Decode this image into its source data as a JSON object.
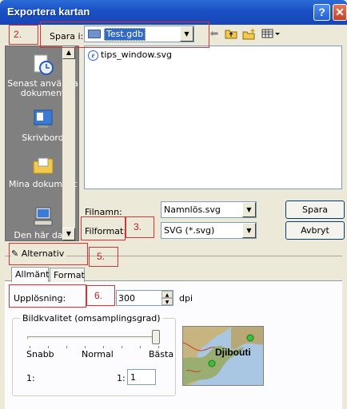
{
  "window": {
    "title": "Exportera kartan",
    "help_label": "?",
    "close_label": "✕"
  },
  "places": [
    {
      "label": "Senast använda dokument",
      "icon": "recent-documents-icon"
    },
    {
      "label": "Skrivbord",
      "icon": "desktop-icon"
    },
    {
      "label": "Mina dokument",
      "icon": "my-documents-icon"
    },
    {
      "label": "Den här dato",
      "icon": "my-computer-icon"
    }
  ],
  "save_in": {
    "label": "Spara i:",
    "value": "Test.gdb"
  },
  "files": [
    {
      "name": "tips_window.svg"
    }
  ],
  "filename": {
    "label": "Filnamn:",
    "value": "Namnlös.svg"
  },
  "fileformat": {
    "label": "Filformat:",
    "value": "SVG (*.svg)"
  },
  "buttons": {
    "save": "Spara",
    "cancel": "Avbryt"
  },
  "options": {
    "label": "Alternativ"
  },
  "tabs": [
    {
      "label": "Allmänt"
    },
    {
      "label": "Format"
    }
  ],
  "resolution": {
    "label": "Upplösning:",
    "value": "300",
    "unit": "dpi"
  },
  "quality": {
    "group_label": "Bildkvalitet (omsamplingsgrad)",
    "labels": [
      "Snabb",
      "Normal",
      "Bästa"
    ],
    "ratio_left": "1:",
    "ratio_prefix": "1:",
    "ratio_value": "1",
    "slider_level_fraction": 1.0
  },
  "preview": {
    "label": "Djibouti"
  },
  "annotations": [
    "2.",
    "3.",
    "5.",
    "6."
  ]
}
